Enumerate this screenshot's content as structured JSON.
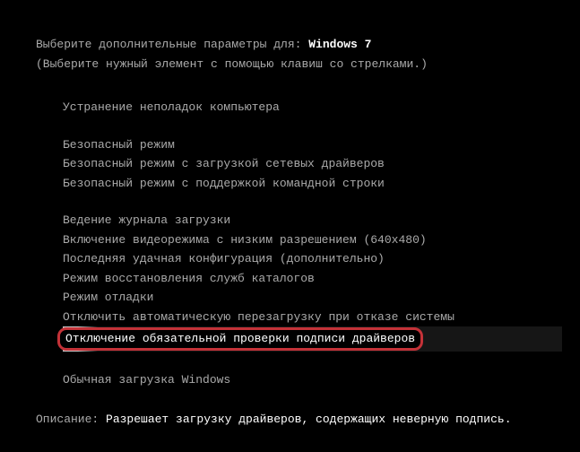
{
  "header": {
    "prompt_prefix": "Выберите дополнительные параметры для: ",
    "os_name": "Windows 7",
    "hint": "(Выберите нужный элемент с помощью клавиш со стрелками.)"
  },
  "menu": {
    "group1": [
      "Устранение неполадок компьютера"
    ],
    "group2": [
      "Безопасный режим",
      "Безопасный режим с загрузкой сетевых драйверов",
      "Безопасный режим с поддержкой командной строки"
    ],
    "group3": [
      "Ведение журнала загрузки",
      "Включение видеорежима с низким разрешением (640x480)",
      "Последняя удачная конфигурация (дополнительно)",
      "Режим восстановления служб каталогов",
      "Режим отладки",
      "Отключить автоматическую перезагрузку при отказе системы"
    ],
    "selected": "Отключение обязательной проверки подписи драйверов",
    "normal": "Обычная загрузка Windows"
  },
  "description": {
    "label": "Описание: ",
    "text": "Разрешает загрузку драйверов, содержащих неверную подпись."
  }
}
